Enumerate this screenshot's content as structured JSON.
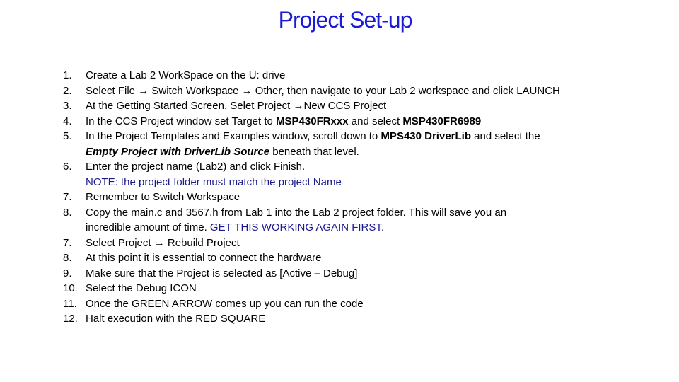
{
  "title": "Project Set-up",
  "colors": {
    "title": "#1a1ad8",
    "note": "#1a1a8c"
  },
  "steps": [
    {
      "num": "1.",
      "parts": [
        "Create a Lab 2 WorkSpace on the U: drive"
      ]
    },
    {
      "num": "2.",
      "parts": [
        "Select File ",
        " Switch Workspace ",
        " Other, then navigate to your Lab 2 workspace and click LAUNCH"
      ],
      "arrow": "→"
    },
    {
      "num": "3.",
      "parts": [
        "At the Getting Started Screen, Selet Project ",
        "New CCS Project"
      ],
      "arrow": "→"
    },
    {
      "num": "4.",
      "parts": [
        "In the CCS Project window set Target to ",
        "MSP430FRxxx",
        " and select ",
        "MSP430FR6989"
      ]
    },
    {
      "num": "5.",
      "parts": [
        "In the Project Templates and Examples window, scroll down to ",
        "MPS430 DriverLib",
        " and select the"
      ]
    },
    {
      "num": "",
      "parts": [
        "Empty Project with DriverLib Source",
        " beneath that level."
      ]
    },
    {
      "num": "6.",
      "parts": [
        "Enter the project name (Lab2) and click Finish."
      ]
    },
    {
      "num": "",
      "parts": [
        "NOTE: the project folder must match the project Name"
      ]
    },
    {
      "num": "7.",
      "parts": [
        "Remember to Switch Workspace"
      ]
    },
    {
      "num": "8.",
      "parts": [
        "Copy the main.c and 3567.h from Lab 1 into the Lab 2 project folder.  This will save you an"
      ]
    },
    {
      "num": "",
      "parts": [
        "incredible amount of time.  ",
        "GET THIS WORKING AGAIN FIRST."
      ]
    },
    {
      "num": "7.",
      "parts": [
        "Select Project ",
        " Rebuild Project"
      ],
      "arrow": "→"
    },
    {
      "num": "8.",
      "parts": [
        " At this point it is essential to connect the hardware"
      ]
    },
    {
      "num": "9.",
      "parts": [
        " Make sure that the Project is selected as [Active – Debug]"
      ]
    },
    {
      "num": "10.",
      "parts": [
        "Select the Debug ICON"
      ]
    },
    {
      "num": "11.",
      "parts": [
        "Once the GREEN ARROW comes up you can run the code"
      ]
    },
    {
      "num": "12.",
      "parts": [
        "Halt execution with the RED SQUARE"
      ]
    }
  ]
}
